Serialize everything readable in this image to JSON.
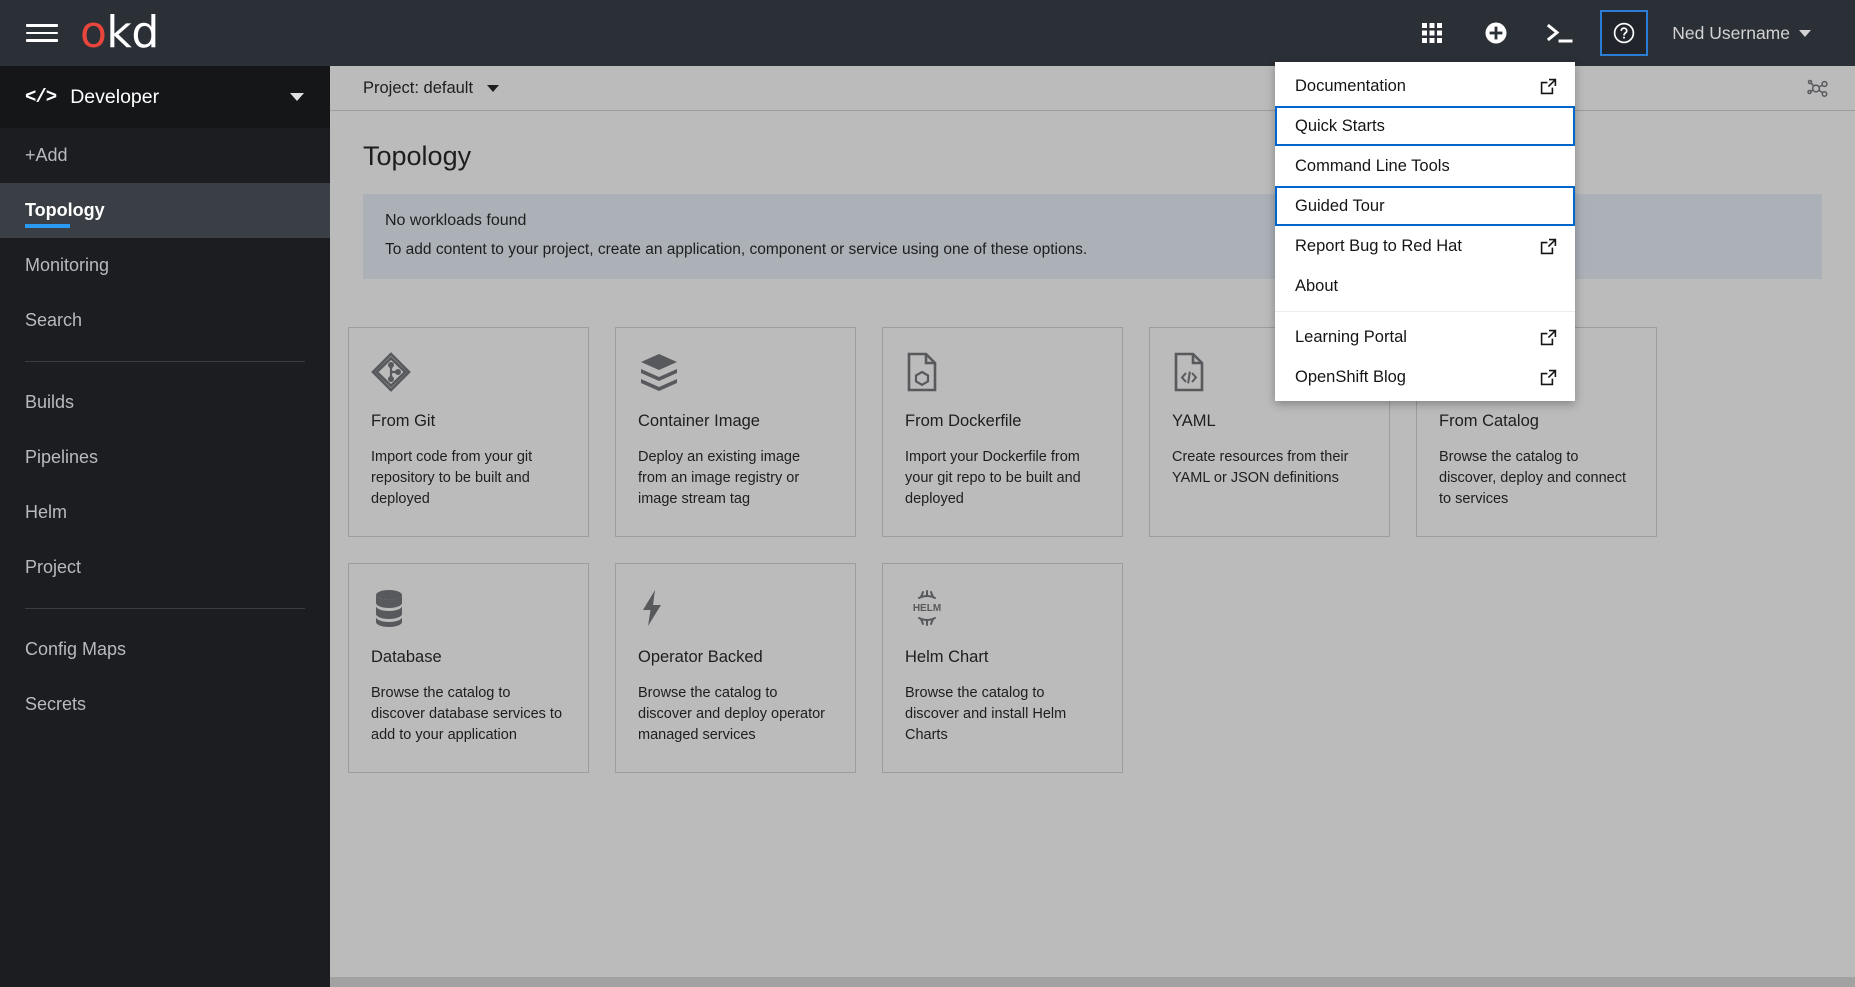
{
  "masthead": {
    "menu_toggle": "Global navigation toggle",
    "brand": {
      "part1": "o",
      "part2": "kd"
    },
    "tools": [
      {
        "name": "application-launcher-icon",
        "label": "Application launcher"
      },
      {
        "name": "plus-circle-icon",
        "label": "Quick create"
      },
      {
        "name": "terminal-icon",
        "label": "Command line terminal"
      },
      {
        "name": "help-icon",
        "label": "Help",
        "focused": true
      }
    ],
    "username": "Ned Username"
  },
  "sidebar": {
    "perspective": {
      "icon": "code-icon",
      "label": "Developer"
    },
    "items": [
      {
        "label": "+Add",
        "active": false
      },
      {
        "label": "Topology",
        "active": true
      },
      {
        "label": "Monitoring",
        "active": false
      },
      {
        "label": "Search",
        "active": false
      },
      {
        "divider": true
      },
      {
        "label": "Builds",
        "active": false
      },
      {
        "label": "Pipelines",
        "active": false
      },
      {
        "label": "Helm",
        "active": false
      },
      {
        "label": "Project",
        "active": false
      },
      {
        "divider": true
      },
      {
        "label": "Config Maps",
        "active": false
      },
      {
        "label": "Secrets",
        "active": false
      }
    ]
  },
  "content": {
    "project_selector": "Project: default",
    "page_title": "Topology",
    "alert": {
      "title": "No workloads found",
      "text": "To add content to your project, create an application, component or service using one of these options."
    },
    "cards": [
      {
        "icon": "git-icon",
        "title": "From Git",
        "desc": "Import code from your git repository to be built and deployed"
      },
      {
        "icon": "container-image-icon",
        "title": "Container Image",
        "desc": "Deploy an existing image from an image registry or image stream tag"
      },
      {
        "icon": "dockerfile-icon",
        "title": "From Dockerfile",
        "desc": "Import your Dockerfile from your git repo to be built and deployed"
      },
      {
        "icon": "yaml-icon",
        "title": "YAML",
        "desc": "Create resources from their YAML or JSON definitions"
      },
      {
        "icon": "catalog-icon",
        "title": "From Catalog",
        "desc": "Browse the catalog to discover, deploy and connect to services"
      },
      {
        "icon": "database-icon",
        "title": "Database",
        "desc": "Browse the catalog to discover database services to add to your application"
      },
      {
        "icon": "operator-icon",
        "title": "Operator Backed",
        "desc": "Browse the catalog to discover and deploy operator managed services"
      },
      {
        "icon": "helm-icon",
        "title": "Helm Chart",
        "desc": "Browse the catalog to discover and install Helm Charts"
      }
    ]
  },
  "help_menu": {
    "items": [
      {
        "label": "Documentation",
        "external": true,
        "focused": false
      },
      {
        "label": "Quick Starts",
        "external": false,
        "focused": true
      },
      {
        "label": "Command Line Tools",
        "external": false,
        "focused": false
      },
      {
        "label": "Guided Tour",
        "external": false,
        "focused": true
      },
      {
        "label": "Report Bug to Red Hat",
        "external": true,
        "focused": false
      },
      {
        "label": "About",
        "external": false,
        "focused": false
      },
      {
        "divider": true
      },
      {
        "label": "Learning Portal",
        "external": true,
        "focused": false
      },
      {
        "label": "OpenShift Blog",
        "external": true,
        "focused": false
      }
    ]
  },
  "colors": {
    "masthead_bg": "#2b2f36",
    "sidebar_bg": "#1b1d21",
    "brand_red": "#e8453c",
    "focus_blue": "#0066cc",
    "active_blue": "#2b9af3",
    "alert_blue": "#e7f1fa"
  }
}
